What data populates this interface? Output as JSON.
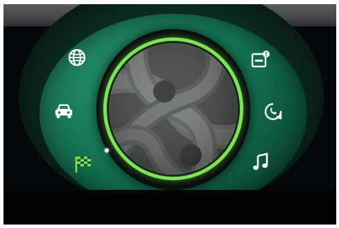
{
  "colors": {
    "dial_green": "#188360",
    "ring_green": "#7fe35a",
    "checkered_flag_green": "#8ee04a",
    "icon_white": "#ffffff"
  },
  "menu": {
    "left": [
      {
        "icon": "globe-icon"
      },
      {
        "icon": "car-icon"
      },
      {
        "icon": "checkered-flag-icon",
        "selected": true
      }
    ],
    "right": [
      {
        "icon": "notification-icon"
      },
      {
        "icon": "phone-icon"
      },
      {
        "icon": "music-note-icon"
      }
    ]
  },
  "center": {
    "artwork": "interlaced-loops-artwork"
  }
}
